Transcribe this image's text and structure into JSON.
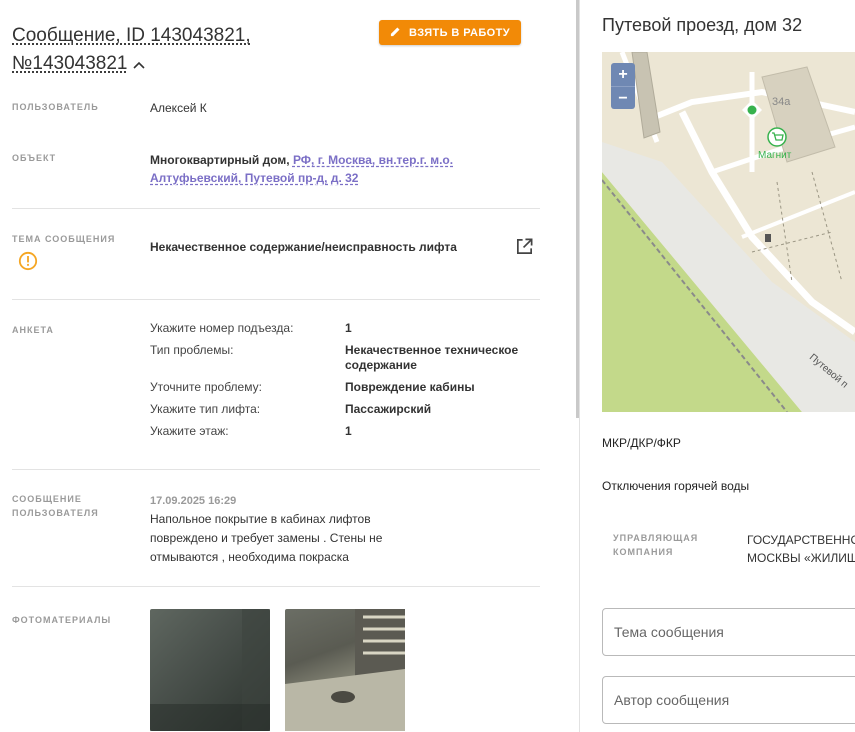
{
  "header": {
    "title_line1": "Сообщение, ID 143043821,",
    "title_line2": "№143043821",
    "take_button_label": "ВЗЯТЬ В РАБОТУ"
  },
  "fields": {
    "user_label": "ПОЛЬЗОВАТЕЛЬ",
    "user_value": "Алексей К",
    "object_label": "ОБЪЕКТ",
    "object_type": "Многоквартирный дом,",
    "object_address": "РФ, г. Москва, вн.тер.г. м.о. Алтуфьевский, Путевой пр-д, д. 32",
    "topic_label": "ТЕМА СООБЩЕНИЯ",
    "topic_value": "Некачественное содержание/неисправность лифта",
    "anketa_label": "АНКЕТА",
    "message_label_1": "СООБЩЕНИЕ",
    "message_label_2": "ПОЛЬЗОВАТЕЛЯ",
    "message_date": "17.09.2025 16:29",
    "message_text": "Напольное покрытие в кабинах лифтов повреждено и требует замены . Стены не отмываются , необходима покраска",
    "photos_label": "ФОТОМАТЕРИАЛЫ"
  },
  "anketa": [
    {
      "q": "Укажите номер подъезда:",
      "a": "1"
    },
    {
      "q": "Тип проблемы:",
      "a": "Некачественное техническое содержание"
    },
    {
      "q": "Уточните проблему:",
      "a": "Повреждение кабины"
    },
    {
      "q": "Укажите тип лифта:",
      "a": "Пассажирский"
    },
    {
      "q": "Укажите этаж:",
      "a": "1"
    }
  ],
  "right": {
    "title": "Путевой проезд, дом 32",
    "map": {
      "zoom_in": "+",
      "zoom_out": "−",
      "building_label": "34а",
      "shop_label": "Магнит",
      "street_label": "Путевой п"
    },
    "mkr": "МКР/ДКР/ФКР",
    "outage": "Отключения горячей воды",
    "company_label_1": "УПРАВЛЯЮЩАЯ",
    "company_label_2": "КОМПАНИЯ",
    "company_line1": "ГОСУДАРСТВЕННОЕ",
    "company_line2": "МОСКВЫ «ЖИЛИЩ",
    "topic_placeholder": "Тема сообщения",
    "author_placeholder": "Автор сообщения"
  },
  "colors": {
    "accent_orange": "#f28a07",
    "link_purple": "#7b6fc6",
    "warning_orange": "#f5a623",
    "map_green": "#c3d98a",
    "map_zoom": "#6f88b3"
  },
  "icons": [
    "pencil-icon",
    "chevron-up-icon",
    "external-link-icon",
    "warning-icon",
    "shop-icon",
    "poi-icon"
  ]
}
